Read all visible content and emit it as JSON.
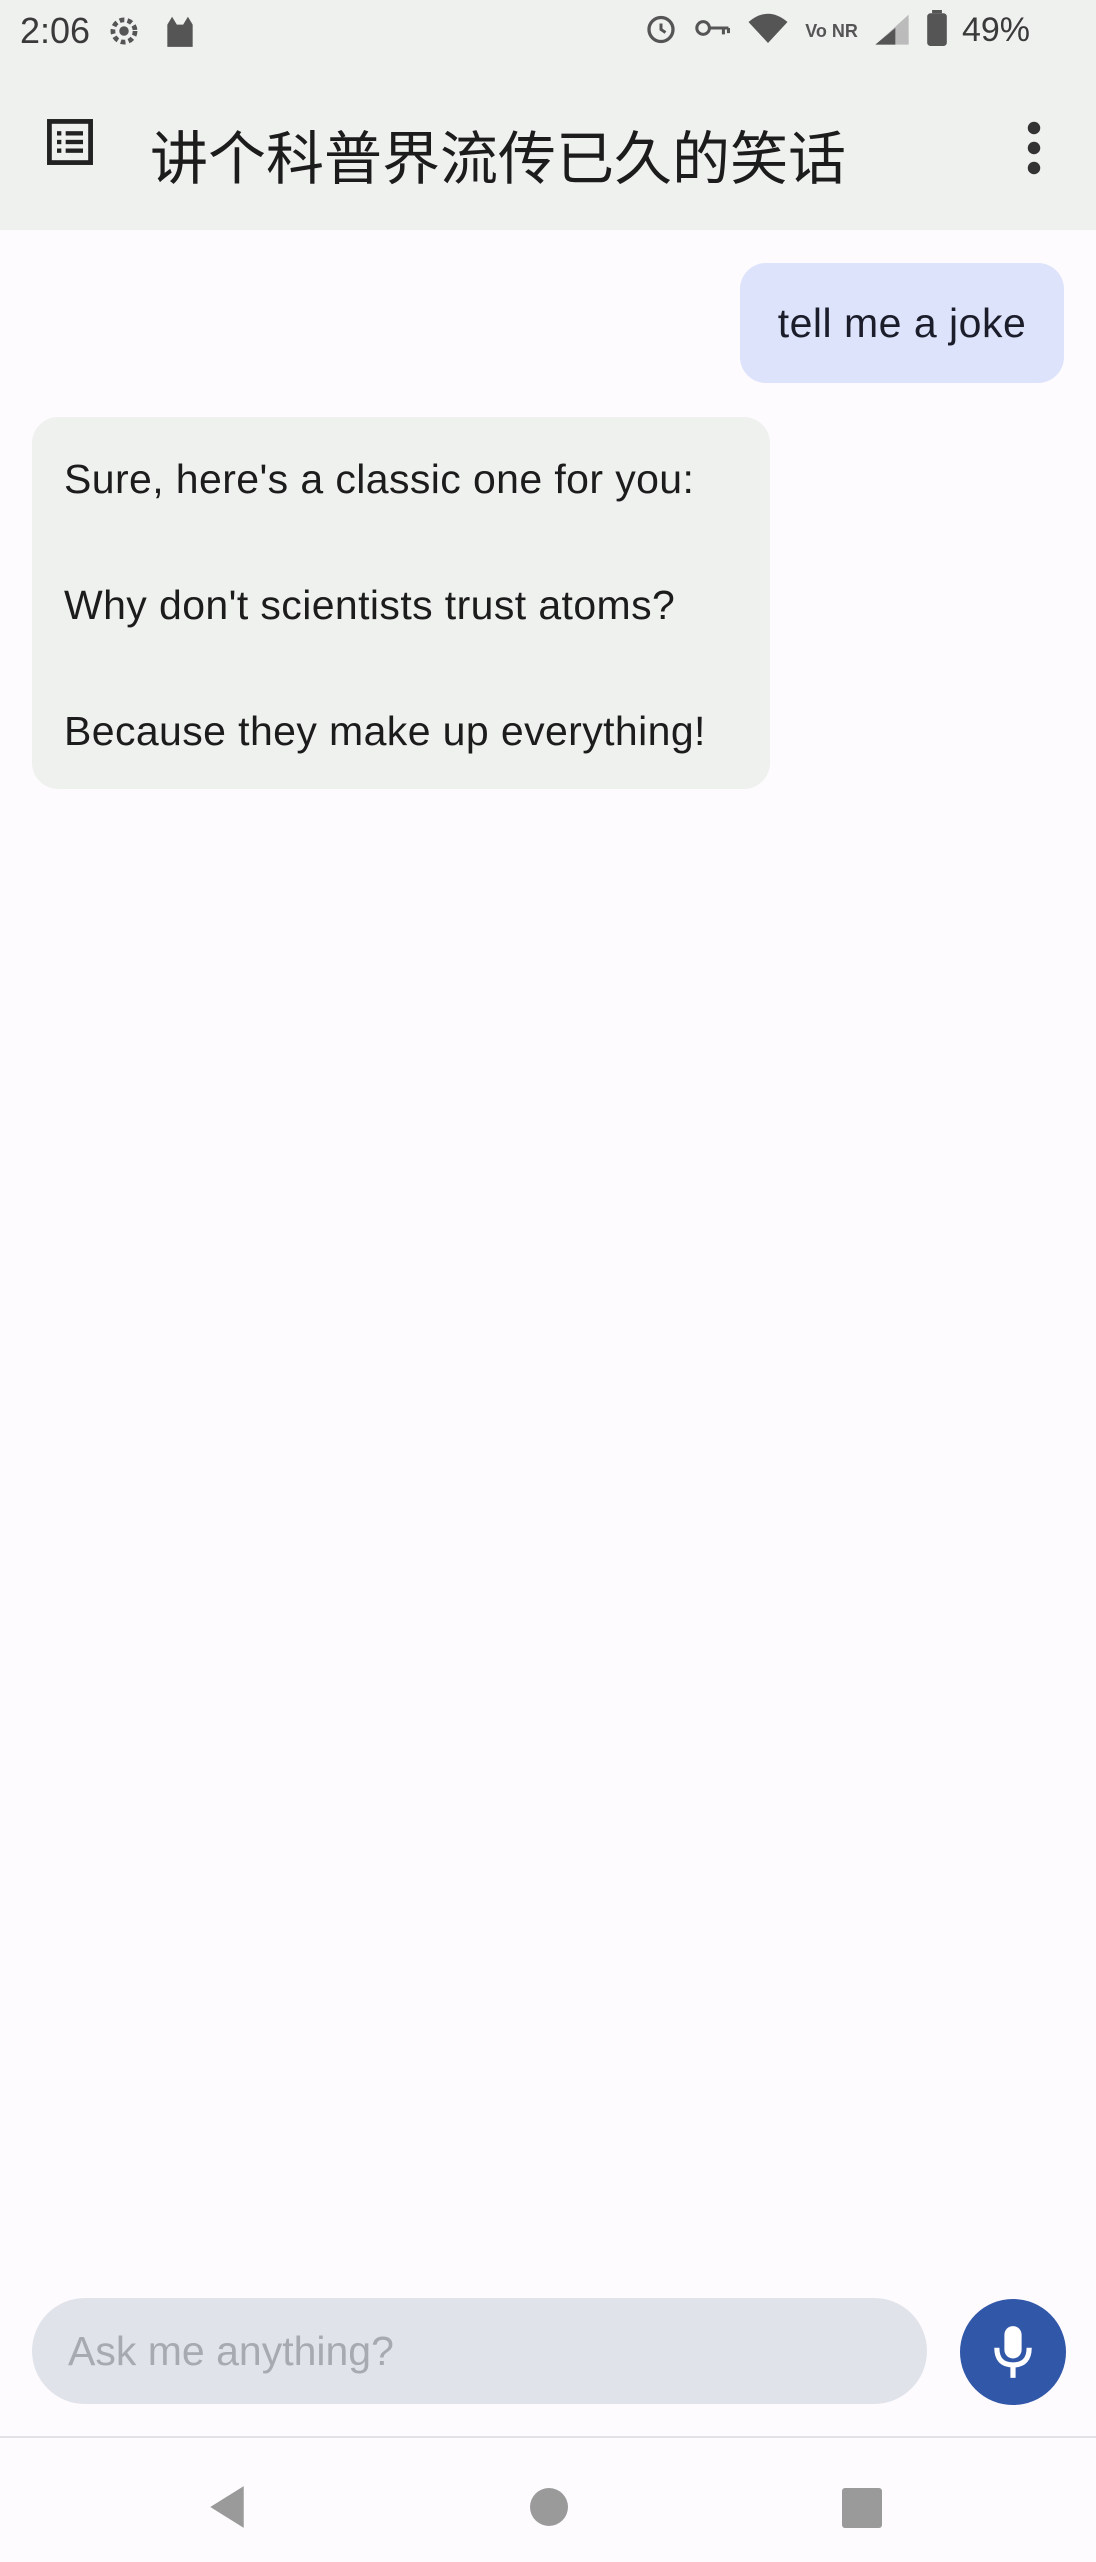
{
  "status_bar": {
    "time": "2:06",
    "battery_percent": "49%",
    "network_label": "Vo NR",
    "left_icons": [
      "settings-gear-icon",
      "cat-app-icon"
    ],
    "right_icons": [
      "alarm-icon",
      "vpn-key-icon",
      "wifi-icon",
      "volte-nr-icon",
      "signal-icon",
      "battery-icon"
    ]
  },
  "app_bar": {
    "title": "讲个科普界流传已久的笑话",
    "menu_icon": "list-menu-icon",
    "more_icon": "more-vertical-icon",
    "background": "#eff1ef"
  },
  "messages": [
    {
      "role": "user",
      "text": "tell me a joke",
      "color": "#dde3fb"
    },
    {
      "role": "assistant",
      "lines": [
        "Sure, here's a classic one for you:",
        "Why don't scientists trust atoms?",
        "Because they make up everything!"
      ],
      "color": "#eff1ef"
    }
  ],
  "composer": {
    "placeholder": "Ask me anything?",
    "value": "",
    "mic_icon": "microphone-icon",
    "mic_color": "#3157a8"
  },
  "nav_bar": {
    "icons": [
      "back-triangle-icon",
      "home-circle-icon",
      "recents-square-icon"
    ]
  }
}
